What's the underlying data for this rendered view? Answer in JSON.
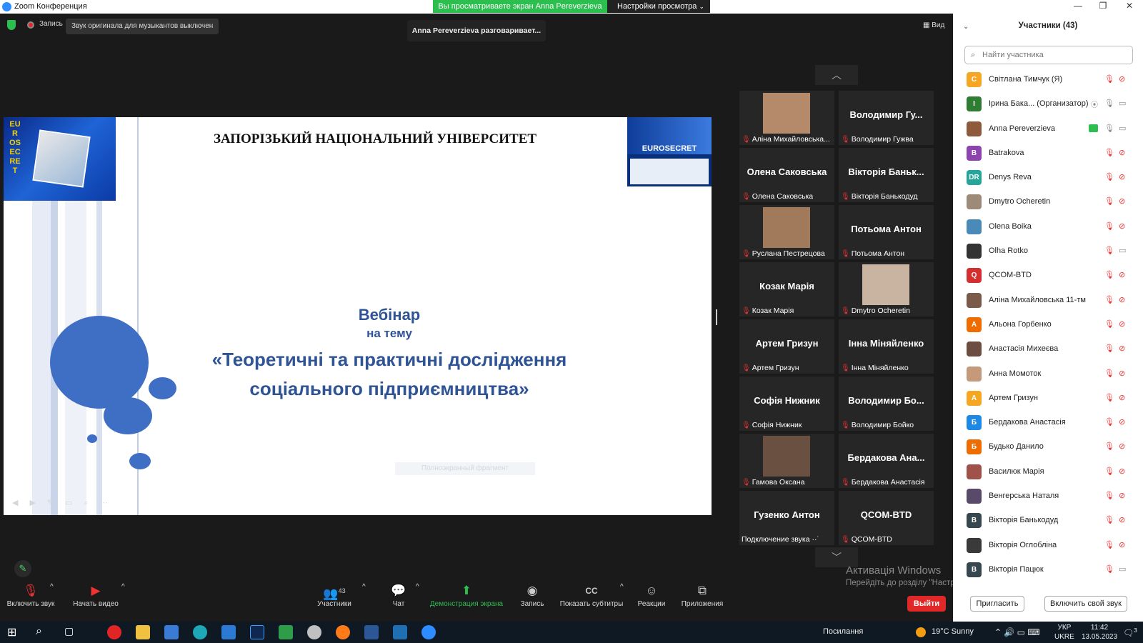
{
  "window": {
    "title": "Zoom Конференция"
  },
  "share": {
    "banner": "Вы просматриваете экран Anna Pereverzieva",
    "settings_label": "Настройки просмотра"
  },
  "topbar": {
    "record_label": "Запись",
    "audio_notice": "Звук оригинала для музыкантов выключен",
    "talking": "Anna Pereverzieva разговаривает...",
    "view_label": "Вид"
  },
  "slide": {
    "university": "ЗАПОРІЗЬКИЙ НАЦІОНАЛЬНИЙ УНІВЕРСИТЕТ",
    "line1": "Вебінар",
    "line2": "на тему",
    "line3": "«Теоретичні та практичні дослідження",
    "line4": "соціального підприємництва»",
    "hint": "Полноэкранный фрагмент",
    "logo_left_text": "EUROSECRET",
    "logo_right_text": "EUROSECRET"
  },
  "gallery": [
    {
      "big": "",
      "name": "Аліна Михайловська...",
      "photo": true,
      "photo_color": "#b58a6a",
      "muted": true
    },
    {
      "big": "Володимир Гу...",
      "name": "Володимир Гужва",
      "photo": false,
      "muted": true
    },
    {
      "big": "Олена Саковська",
      "name": "Олена Саковська",
      "photo": false,
      "muted": true
    },
    {
      "big": "Вікторія Баньк...",
      "name": "Вікторія Банькодуд",
      "photo": false,
      "muted": true
    },
    {
      "big": "",
      "name": "Руслана Пестрецова",
      "photo": true,
      "photo_color": "#a07a5a",
      "muted": true
    },
    {
      "big": "Потьома Антон",
      "name": "Потьома Антон",
      "photo": false,
      "muted": true
    },
    {
      "big": "Козак Марія",
      "name": "Козак Марія",
      "photo": false,
      "muted": true
    },
    {
      "big": "",
      "name": "Dmytro Ocheretin",
      "photo": true,
      "photo_color": "#c8b4a0",
      "muted": true
    },
    {
      "big": "Артем Гризун",
      "name": "Артем Гризун",
      "photo": false,
      "muted": true
    },
    {
      "big": "Інна Міняйленко",
      "name": "Інна Міняйленко",
      "photo": false,
      "muted": true
    },
    {
      "big": "Софія Нижник",
      "name": "Софія Нижник",
      "photo": false,
      "muted": true
    },
    {
      "big": "Володимир Бо...",
      "name": "Володимир Бойко",
      "photo": false,
      "muted": true
    },
    {
      "big": "",
      "name": "Гамова Оксана",
      "photo": true,
      "photo_color": "#6a5040",
      "muted": true
    },
    {
      "big": "Бердакова Ана...",
      "name": "Бердакова Анастасія",
      "photo": false,
      "muted": true
    },
    {
      "big": "Гузенко Антон",
      "name": "Подключение звука ··˙",
      "photo": false,
      "muted": false
    },
    {
      "big": "QCOM-BTD",
      "name": "QCOM-BTD",
      "photo": false,
      "muted": true
    }
  ],
  "toolbar": {
    "unmute": "Включить звук",
    "start_video": "Начать видео",
    "participants": "Участники",
    "participants_count": "43",
    "chat": "Чат",
    "share": "Демонстрация экрана",
    "record": "Запись",
    "captions": "Показать субтитры",
    "reactions": "Реакции",
    "apps": "Приложения",
    "leave": "Выйти"
  },
  "watermark": {
    "line1": "Активація Windows",
    "line2": "Перейдіть до розділу \"Настройки\", щоб активувати Windows."
  },
  "panel": {
    "title": "Участники (43)",
    "search_placeholder": "Найти участника",
    "invite": "Пригласить",
    "unmute_self": "Включить свой звук",
    "participants": [
      {
        "name": "Світлана Тимчук (Я)",
        "initial": "С",
        "color": "#f5a623",
        "mic": "muted",
        "video": "off"
      },
      {
        "name": "Ірина Бака...  (Организатор)",
        "initial": "І",
        "color": "#2e7d32",
        "mic": "on",
        "video": "on",
        "extra": "⦿"
      },
      {
        "name": "Anna Pereverzieva",
        "initial": "",
        "color": "#8d5b3c",
        "mic": "on",
        "video": "on",
        "sharing": true
      },
      {
        "name": "Batrakova",
        "initial": "B",
        "color": "#8e44ad",
        "mic": "muted",
        "video": "off"
      },
      {
        "name": "Denys Reva",
        "initial": "DR",
        "color": "#26a69a",
        "mic": "muted",
        "video": "off"
      },
      {
        "name": "Dmytro Ocheretin",
        "initial": "",
        "color": "#9e8a78",
        "mic": "muted",
        "video": "off"
      },
      {
        "name": "Olena Boika",
        "initial": "",
        "color": "#4a8ab8",
        "mic": "muted",
        "video": "off"
      },
      {
        "name": "Olha Rotko",
        "initial": "",
        "color": "#333333",
        "mic": "muted",
        "video": "on"
      },
      {
        "name": "QCOM-BTD",
        "initial": "Q",
        "color": "#d32f2f",
        "mic": "muted",
        "video": "off"
      },
      {
        "name": "Аліна Михайловська 11-тм",
        "initial": "",
        "color": "#7a5a48",
        "mic": "muted",
        "video": "off"
      },
      {
        "name": "Альона Горбенко",
        "initial": "А",
        "color": "#ef6c00",
        "mic": "muted",
        "video": "off"
      },
      {
        "name": "Анастасія Михеєва",
        "initial": "",
        "color": "#6d4c41",
        "mic": "muted",
        "video": "off"
      },
      {
        "name": "Анна Момоток",
        "initial": "",
        "color": "#c49a7a",
        "mic": "muted",
        "video": "off"
      },
      {
        "name": "Артем Гризун",
        "initial": "А",
        "color": "#f5a623",
        "mic": "muted",
        "video": "off"
      },
      {
        "name": "Бердакова Анастасія",
        "initial": "Б",
        "color": "#1e88e5",
        "mic": "muted",
        "video": "off"
      },
      {
        "name": "Будько Данило",
        "initial": "Б",
        "color": "#ef6c00",
        "mic": "muted",
        "video": "off"
      },
      {
        "name": "Василюк Марія",
        "initial": "",
        "color": "#a0524a",
        "mic": "muted",
        "video": "off"
      },
      {
        "name": "Венгерська Наталя",
        "initial": "",
        "color": "#5a4a6a",
        "mic": "muted",
        "video": "off"
      },
      {
        "name": "Вікторія Банькодуд",
        "initial": "В",
        "color": "#37474f",
        "mic": "muted",
        "video": "off"
      },
      {
        "name": "Вікторія Оглобліна",
        "initial": "",
        "color": "#3a3a3a",
        "mic": "muted",
        "video": "off"
      },
      {
        "name": "Вікторія Пацюк",
        "initial": "В",
        "color": "#37474f",
        "mic": "muted",
        "video": "on"
      }
    ]
  },
  "taskbar": {
    "news": "Посилання",
    "weather": "19°C  Sunny",
    "lang1": "УКР",
    "lang2": "UKRE",
    "time": "11:42",
    "date": "13.05.2023",
    "notif_count": "3"
  },
  "colors": {
    "accent": "#2d8cff",
    "green": "#2dbe50",
    "muted": "#e33333",
    "slide_text": "#2f5496"
  }
}
